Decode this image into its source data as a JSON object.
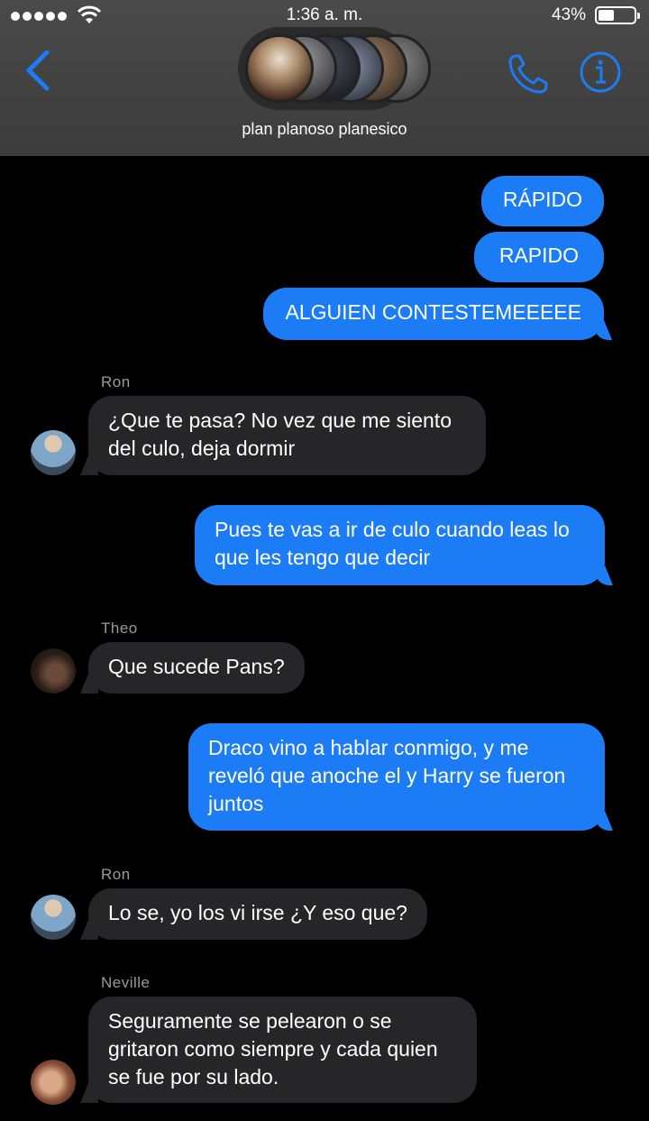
{
  "status_bar": {
    "time": "1:36 a. m.",
    "battery": "43%"
  },
  "nav": {
    "group_name": "plan planoso planesico",
    "icons": [
      "chevron-left-icon",
      "phone-icon",
      "info-icon"
    ],
    "accent_color": "#1b7cf5"
  },
  "messages": [
    {
      "type": "outgoing",
      "text": "RÁPIDO"
    },
    {
      "type": "outgoing",
      "text": "RAPIDO"
    },
    {
      "type": "outgoing",
      "text": "ALGUIEN CONTESTEMEEEEE"
    },
    {
      "type": "incoming",
      "sender": "Ron",
      "text": "¿Que te pasa? No vez que me siento del culo, deja dormir"
    },
    {
      "type": "outgoing",
      "text": "Pues te vas a ir de culo cuando leas lo que les tengo que decir"
    },
    {
      "type": "incoming",
      "sender": "Theo",
      "text": "Que sucede Pans?"
    },
    {
      "type": "outgoing",
      "text": "Draco vino a hablar conmigo, y me reveló que anoche el y Harry se fueron juntos"
    },
    {
      "type": "incoming",
      "sender": "Ron",
      "text": "Lo se, yo los vi irse ¿Y eso que?"
    },
    {
      "type": "incoming",
      "sender": "Neville",
      "text": "Seguramente se pelearon o se gritaron como siempre y cada quien se fue por su lado."
    }
  ]
}
